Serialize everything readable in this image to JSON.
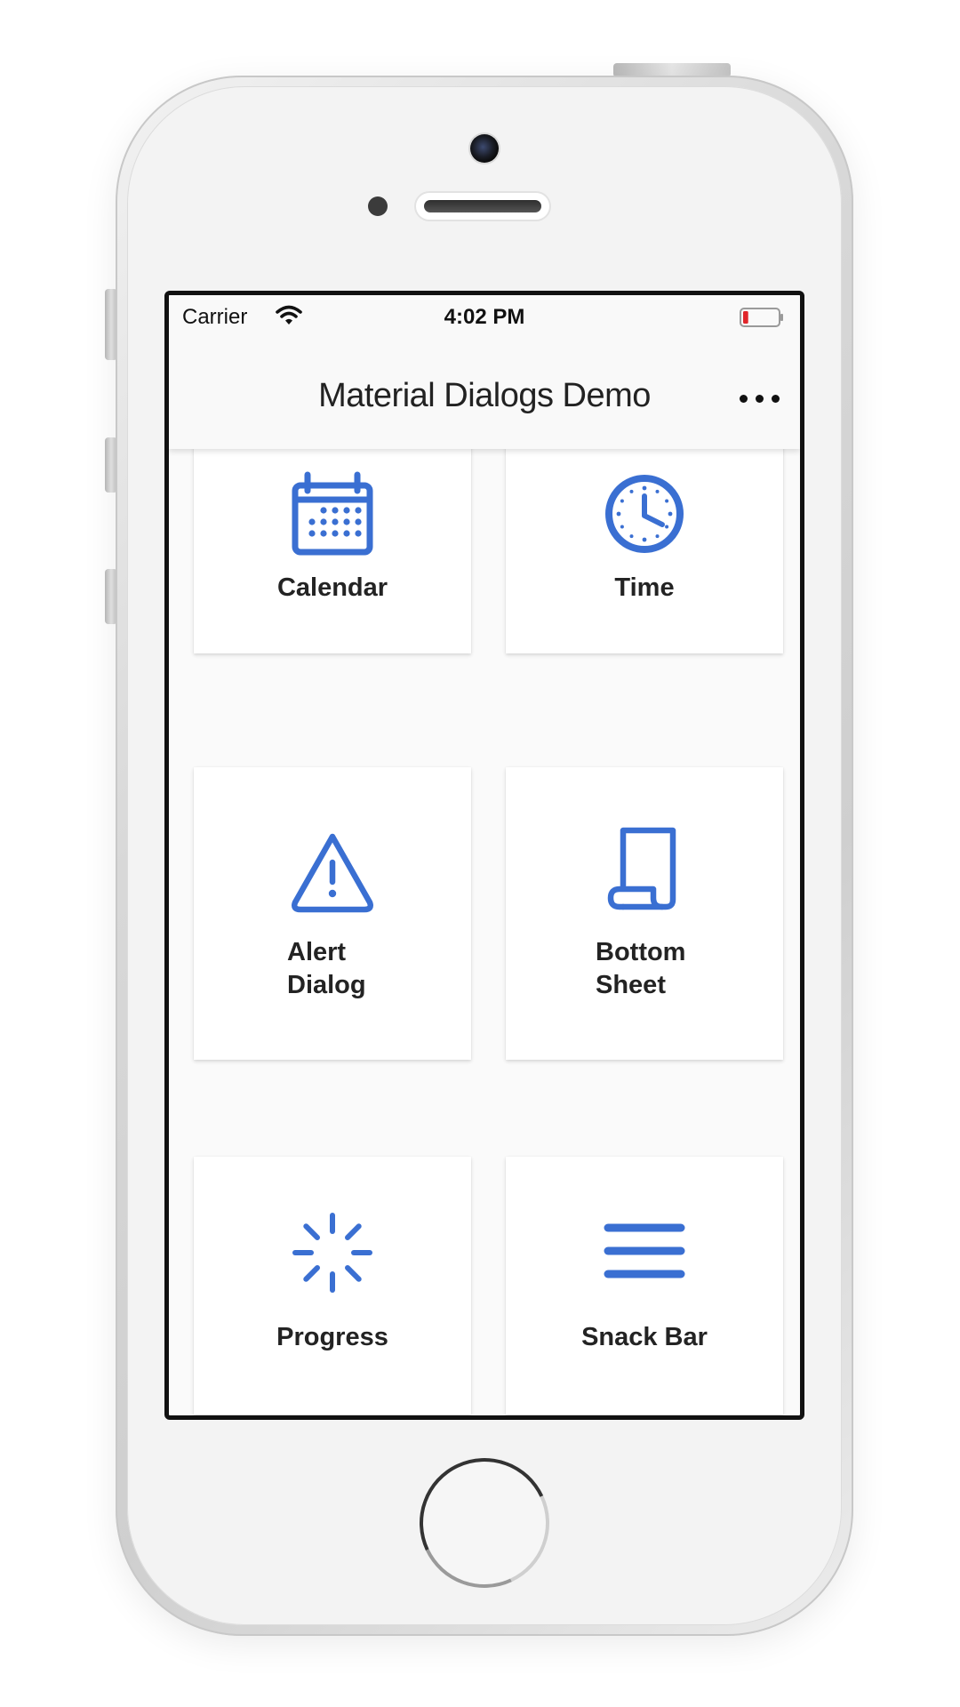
{
  "status_bar": {
    "carrier": "Carrier",
    "time": "4:02 PM",
    "battery_level": 0.1
  },
  "nav": {
    "title": "Material Dialogs Demo",
    "more_icon": "more-horizontal-icon"
  },
  "colors": {
    "accent": "#3a6fd2",
    "screen_background": "#fafafa",
    "card_background": "#ffffff",
    "text": "#232323",
    "battery_low": "#e0262b"
  },
  "cards": [
    {
      "label": "Calendar",
      "icon": "calendar-icon"
    },
    {
      "label": "Time",
      "icon": "clock-icon"
    },
    {
      "label": "Alert\nDialog",
      "icon": "alert-triangle-icon"
    },
    {
      "label": "Bottom\nSheet",
      "icon": "scroll-icon"
    },
    {
      "label": "Progress",
      "icon": "loader-icon"
    },
    {
      "label": "Snack Bar",
      "icon": "menu-icon"
    }
  ]
}
